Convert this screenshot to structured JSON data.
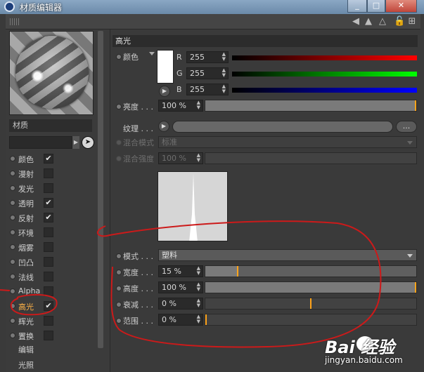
{
  "window": {
    "title": "材质编辑器",
    "min_label": "_",
    "max_label": "□",
    "close_label": "✕"
  },
  "toolbar": {
    "icons": [
      "arrow-left-icon",
      "arrow-up-icon",
      "triangle-icon",
      "lock-icon",
      "new-window-icon"
    ],
    "glyphs": {
      "back": "◀",
      "up": "▲",
      "tri": "△",
      "lock": "🔓",
      "win": "⊞"
    }
  },
  "left": {
    "material_label": "材质",
    "channels": [
      {
        "label": "颜色",
        "checked": true,
        "check": "✔"
      },
      {
        "label": "漫射",
        "checked": false,
        "check": ""
      },
      {
        "label": "发光",
        "checked": false,
        "check": ""
      },
      {
        "label": "透明",
        "checked": true,
        "check": "✔"
      },
      {
        "label": "反射",
        "checked": true,
        "check": "✔"
      },
      {
        "label": "环境",
        "checked": false,
        "check": ""
      },
      {
        "label": "烟雾",
        "checked": false,
        "check": ""
      },
      {
        "label": "凹凸",
        "checked": false,
        "check": ""
      },
      {
        "label": "法线",
        "checked": false,
        "check": ""
      },
      {
        "label": "Alpha",
        "checked": false,
        "check": ""
      },
      {
        "label": "高光",
        "checked": true,
        "check": "✔",
        "active": true
      },
      {
        "label": "辉光",
        "checked": false,
        "check": ""
      },
      {
        "label": "置换",
        "checked": false,
        "check": ""
      }
    ],
    "extra": [
      "编辑",
      "光照"
    ]
  },
  "right": {
    "section_title": "高光",
    "color": {
      "label": "颜色",
      "swatch": "#ffffff",
      "r_label": "R",
      "r_value": "255",
      "g_label": "G",
      "g_value": "255",
      "b_label": "B",
      "b_value": "255",
      "accent_r": "#ff0000",
      "accent_g": "#00ff00",
      "accent_b": "#0000ff"
    },
    "brightness": {
      "label": "亮度 . . .",
      "value": "100 %",
      "level": 1.0
    },
    "texture": {
      "label": "纹理 . . .",
      "dots": "..."
    },
    "blend_mode": {
      "label": "混合模式",
      "value": "标准"
    },
    "blend_strength": {
      "label": "混合强度",
      "value": "100 %"
    },
    "mode": {
      "label": "模式 . . .",
      "value": "塑料"
    },
    "width": {
      "label": "宽度 . . .",
      "value": "15 %",
      "level": 0.15
    },
    "height": {
      "label": "高度 . . .",
      "value": "100 %",
      "level": 1.0
    },
    "falloff": {
      "label": "衰减 . . .",
      "value": "0 %",
      "level": 0.5
    },
    "inner_width": {
      "label": "范围 . . .",
      "value": "0 %",
      "level": 0.0
    }
  },
  "watermark": {
    "brand": "Bai  经验",
    "url": "jingyan.baidu.com"
  }
}
